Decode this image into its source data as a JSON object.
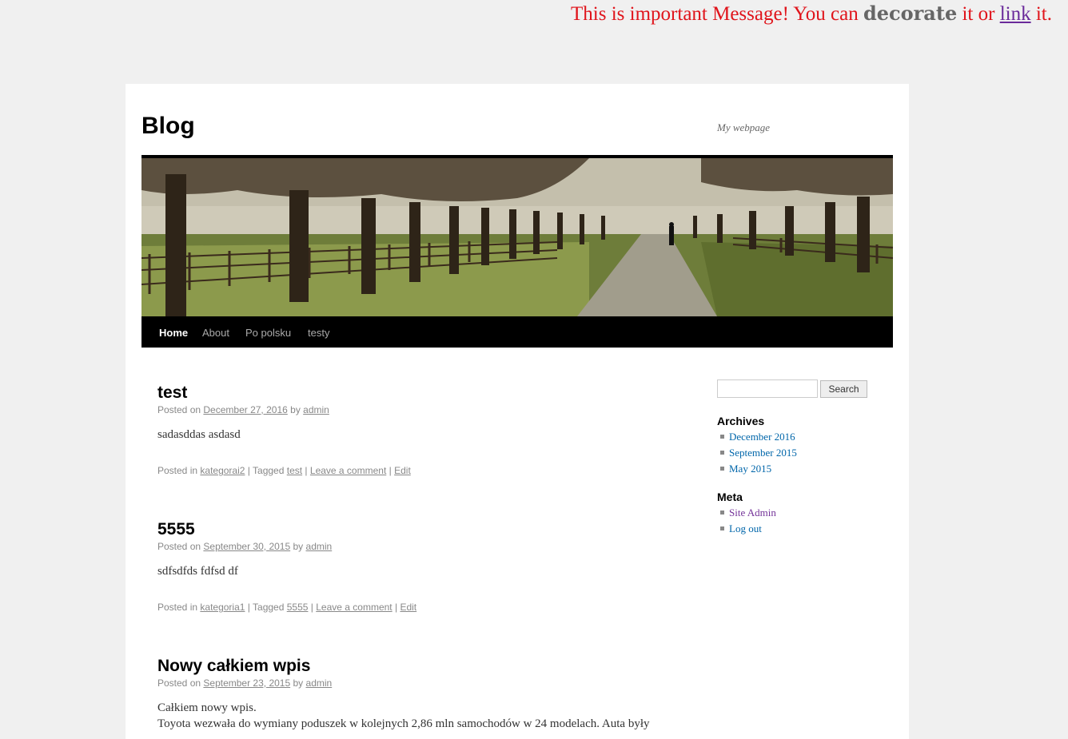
{
  "banner": {
    "part1": "This is important Message! You can",
    "decorate": "decorate",
    "part2": "it or",
    "link": "link",
    "part3": "it."
  },
  "site": {
    "title": "Blog",
    "description": "My webpage"
  },
  "nav": [
    "Home",
    "About",
    "Po polsku",
    "testy"
  ],
  "posts": [
    {
      "title": "test",
      "posted_on": "Posted on",
      "date": "December 27, 2016",
      "by": "by",
      "author": "admin",
      "content": "sadasddas asdasd",
      "posted_in": "Posted in",
      "category": "kategorai2",
      "tagged": "| Tagged",
      "tag": "test",
      "comment": "Leave a comment",
      "edit": "Edit"
    },
    {
      "title": "5555",
      "posted_on": "Posted on",
      "date": "September 30, 2015",
      "by": "by",
      "author": "admin",
      "content": "sdfsdfds fdfsd df",
      "posted_in": "Posted in",
      "category": "kategoria1",
      "tagged": "| Tagged",
      "tag": "5555",
      "comment": "Leave a comment",
      "edit": "Edit"
    },
    {
      "title": "Nowy całkiem wpis",
      "posted_on": "Posted on",
      "date": "September 23, 2015",
      "by": "by",
      "author": "admin",
      "content": "Całkiem nowy wpis.",
      "content2": "Toyota wezwała do wymiany poduszek w kolejnych 2,86 mln samochodów w 24 modelach. Auta były"
    }
  ],
  "sidebar": {
    "search_button": "Search",
    "archives_title": "Archives",
    "archives": [
      "December 2016",
      "September 2015",
      "May 2015"
    ],
    "meta_title": "Meta",
    "meta": [
      "Site Admin",
      "Log out"
    ]
  },
  "colors": {
    "banner_red": "#e0141b",
    "link_blue": "#0066aa",
    "link_visited": "#743399"
  }
}
